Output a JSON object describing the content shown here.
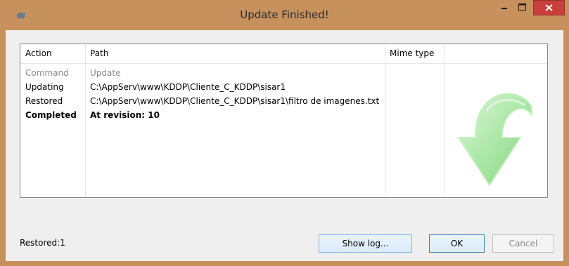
{
  "window": {
    "title": "Update Finished!"
  },
  "table": {
    "headers": [
      "Action",
      "Path",
      "Mime type"
    ],
    "rows": [
      {
        "action": "Command",
        "path": "Update",
        "mime": "",
        "style": "muted"
      },
      {
        "action": "Updating",
        "path": "C:\\AppServ\\www\\KDDP\\Cliente_C_KDDP\\sisar1",
        "mime": "",
        "style": "normal"
      },
      {
        "action": "Restored",
        "path": "C:\\AppServ\\www\\KDDP\\Cliente_C_KDDP\\sisar1\\filtro de imagenes.txt",
        "mime": "",
        "style": "normal"
      },
      {
        "action": "Completed",
        "path": "At revision: 10",
        "mime": "",
        "style": "bold"
      }
    ]
  },
  "status": {
    "text": "Restored:1"
  },
  "buttons": {
    "show_log": "Show log...",
    "ok": "OK",
    "cancel": "Cancel"
  },
  "colors": {
    "window_frame": "#c7915e",
    "close_button": "#c7403c",
    "arrow": "#8fdc8a"
  }
}
